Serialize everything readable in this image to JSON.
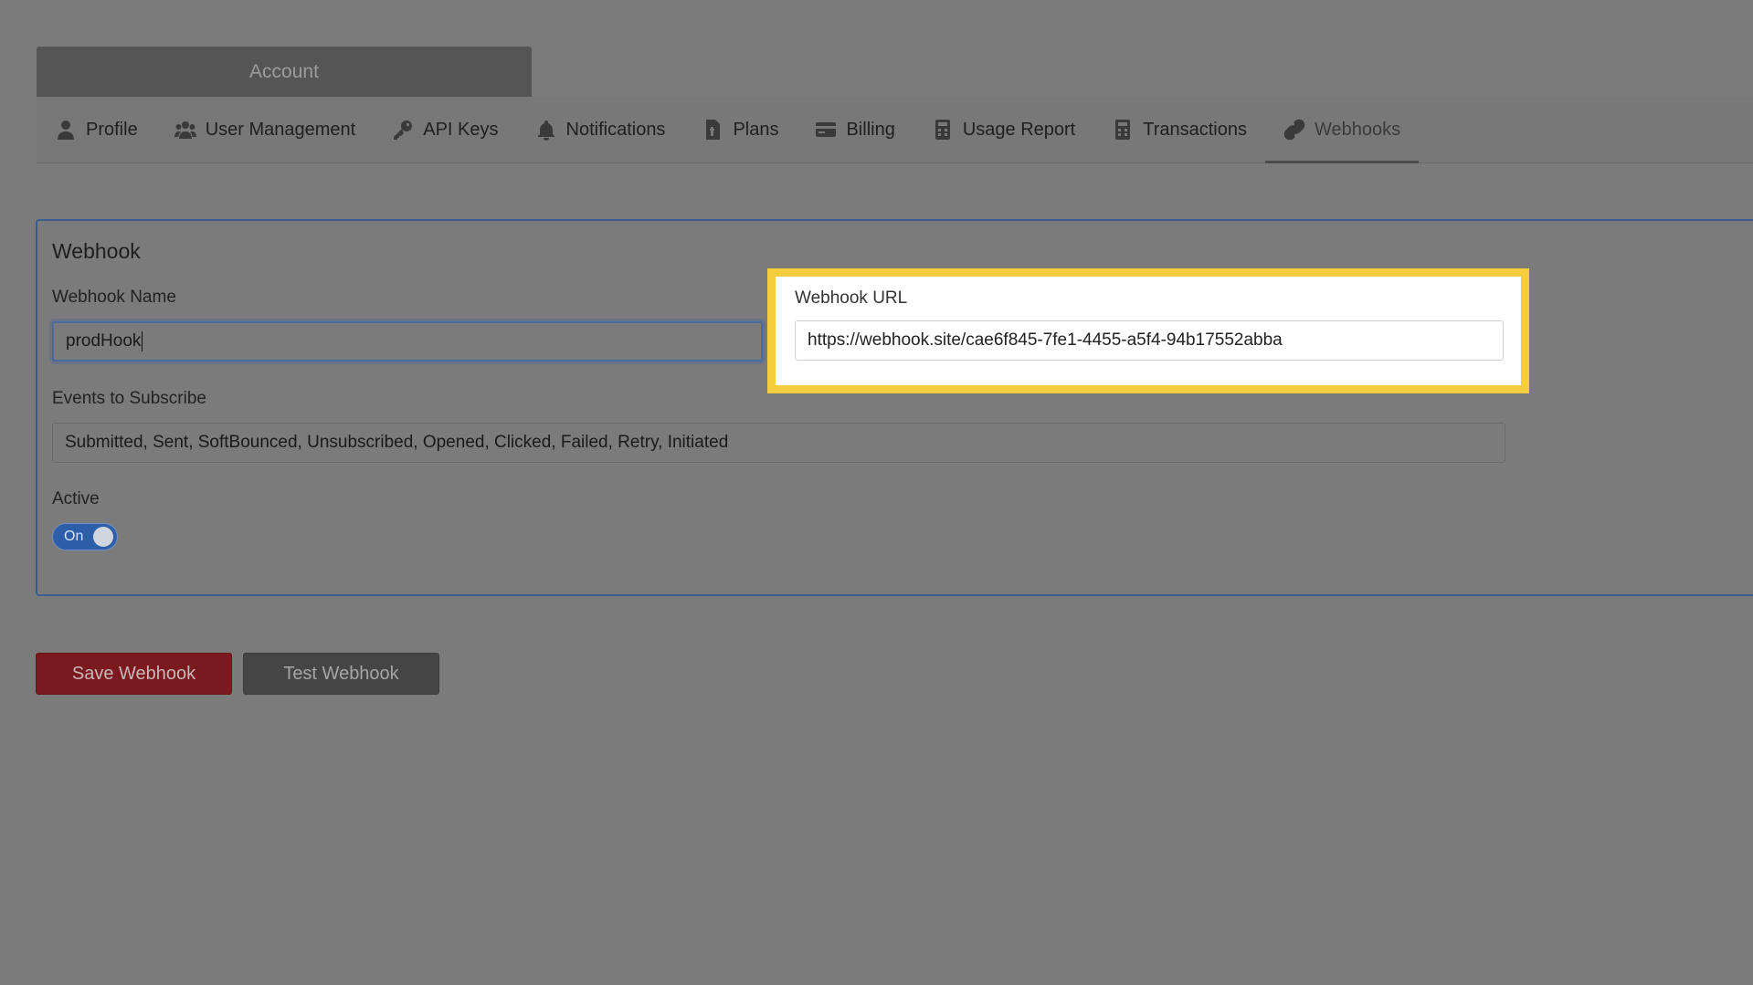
{
  "account": {
    "title": "Account"
  },
  "tabs": [
    {
      "label": "Profile",
      "icon": "person-icon"
    },
    {
      "label": "User Management",
      "icon": "users-icon"
    },
    {
      "label": "API Keys",
      "icon": "key-icon"
    },
    {
      "label": "Notifications",
      "icon": "bell-icon"
    },
    {
      "label": "Plans",
      "icon": "file-dollar-icon"
    },
    {
      "label": "Billing",
      "icon": "credit-card-icon"
    },
    {
      "label": "Usage Report",
      "icon": "calculator-icon"
    },
    {
      "label": "Transactions",
      "icon": "calculator-icon"
    },
    {
      "label": "Webhooks",
      "icon": "link-icon",
      "active": true
    }
  ],
  "webhook": {
    "card_title": "Webhook",
    "name_label": "Webhook Name",
    "name_value": "prodHook",
    "url_label": "Webhook URL",
    "url_value": "https://webhook.site/cae6f845-7fe1-4455-a5f4-94b17552abba",
    "events_label": "Events to Subscribe",
    "events_value": "Submitted, Sent, SoftBounced, Unsubscribed, Opened, Clicked, Failed, Retry, Initiated",
    "active_label": "Active",
    "active_toggle_text": "On",
    "active": true
  },
  "actions": {
    "save_label": "Save Webhook",
    "test_label": "Test Webhook"
  },
  "colors": {
    "highlight_border": "#f5cd3d",
    "save_button": "#7a1a1e",
    "test_button": "#454545",
    "toggle_on": "#2f5ea8"
  }
}
